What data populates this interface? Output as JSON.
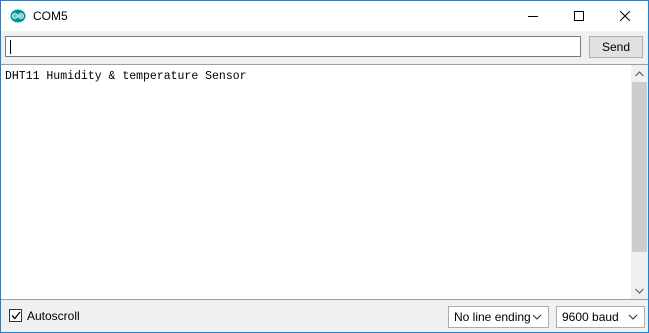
{
  "window": {
    "title": "COM5",
    "icon": "arduino-icon",
    "controls": [
      "minimize-icon",
      "maximize-icon",
      "close-icon"
    ]
  },
  "send_bar": {
    "input_value": "",
    "send_label": "Send"
  },
  "output": {
    "text": "DHT11 Humidity & temperature Sensor"
  },
  "status_bar": {
    "autoscroll_label": "Autoscroll",
    "autoscroll_checked": true,
    "line_ending": "No line ending",
    "baud": "9600 baud"
  },
  "colors": {
    "window_border": "#1883d7",
    "arduino_teal": "#00979c"
  }
}
